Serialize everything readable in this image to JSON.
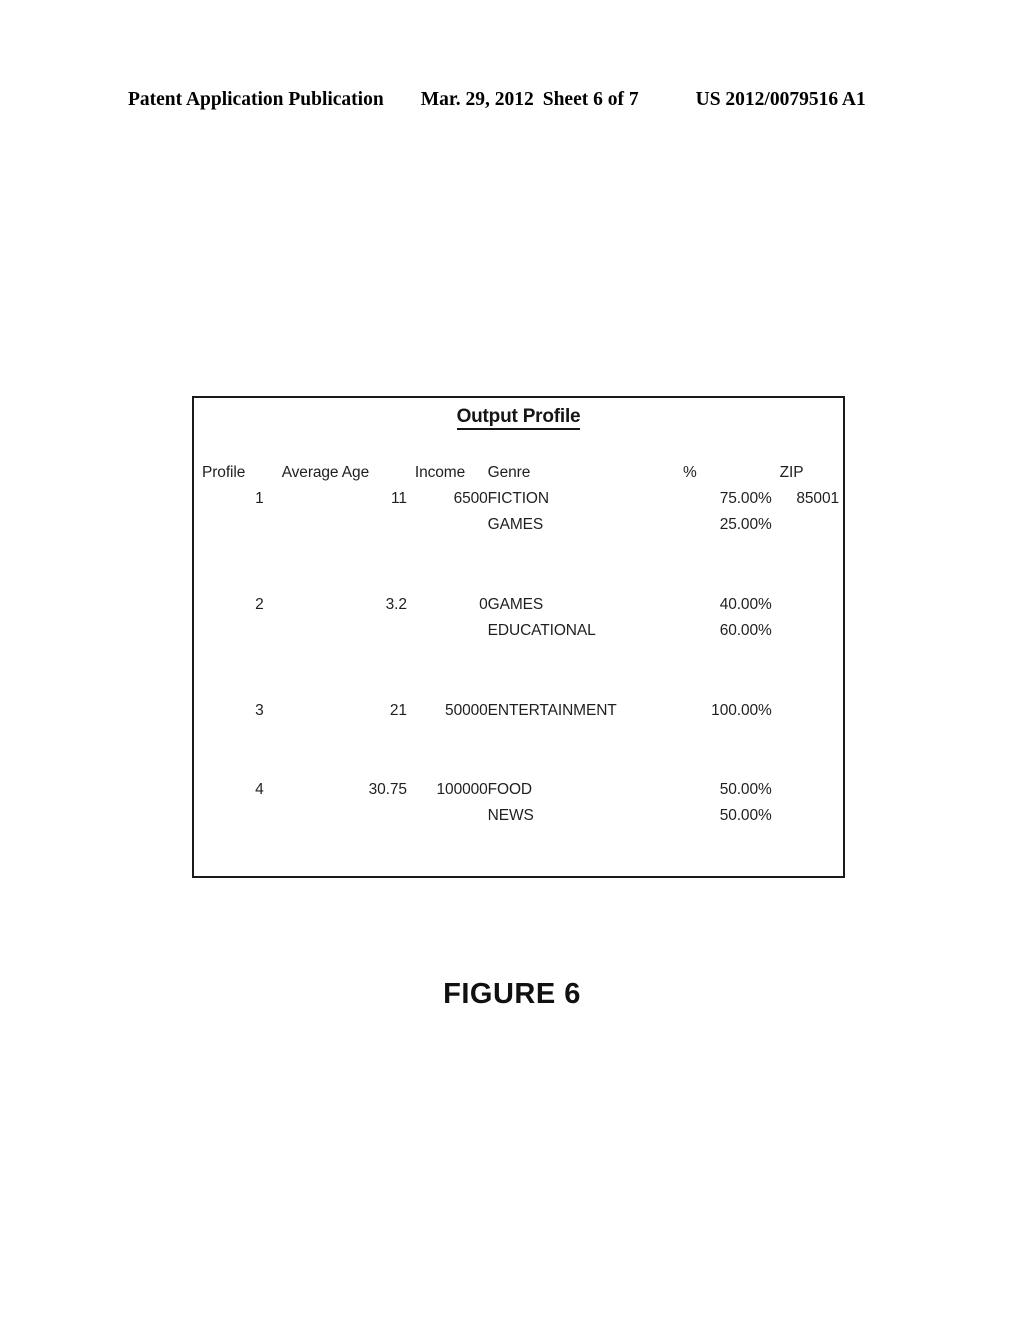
{
  "header": {
    "publication": "Patent Application Publication",
    "date": "Mar. 29, 2012",
    "sheet": "Sheet 6 of 7",
    "document_number": "US 2012/0079516 A1"
  },
  "figure": {
    "caption": "FIGURE 6",
    "table_title": "Output Profile",
    "columns": [
      {
        "key": "profile",
        "label": "Profile"
      },
      {
        "key": "average_age",
        "label": "Average Age"
      },
      {
        "key": "income",
        "label": "Income"
      },
      {
        "key": "genre",
        "label": "Genre"
      },
      {
        "key": "percent",
        "label": "%"
      },
      {
        "key": "zip",
        "label": "ZIP"
      }
    ],
    "rows": [
      {
        "profile": "1",
        "average_age": "11",
        "income": "6500",
        "genre": "FICTION",
        "percent": "75.00%",
        "zip": "85001"
      },
      {
        "profile": "",
        "average_age": "",
        "income": "",
        "genre": "GAMES",
        "percent": "25.00%",
        "zip": ""
      },
      {
        "profile": "",
        "average_age": "",
        "income": "",
        "genre": "",
        "percent": "",
        "zip": ""
      },
      {
        "profile": "2",
        "average_age": "3.2",
        "income": "0",
        "genre": "GAMES",
        "percent": "40.00%",
        "zip": ""
      },
      {
        "profile": "",
        "average_age": "",
        "income": "",
        "genre": "EDUCATIONAL",
        "percent": "60.00%",
        "zip": ""
      },
      {
        "profile": "",
        "average_age": "",
        "income": "",
        "genre": "",
        "percent": "",
        "zip": ""
      },
      {
        "profile": "3",
        "average_age": "21",
        "income": "50000",
        "genre": "ENTERTAINMENT",
        "percent": "100.00%",
        "zip": ""
      },
      {
        "profile": "",
        "average_age": "",
        "income": "",
        "genre": "",
        "percent": "",
        "zip": ""
      },
      {
        "profile": "4",
        "average_age": "30.75",
        "income": "100000",
        "genre": "FOOD",
        "percent": "50.00%",
        "zip": ""
      },
      {
        "profile": "",
        "average_age": "",
        "income": "",
        "genre": "NEWS",
        "percent": "50.00%",
        "zip": ""
      }
    ]
  },
  "chart_data": {
    "type": "table",
    "title": "Output Profile",
    "columns": [
      "Profile",
      "Average Age",
      "Income",
      "Genre",
      "%",
      "ZIP"
    ],
    "rows": [
      [
        "1",
        "11",
        "6500",
        "FICTION",
        "75.00%",
        "85001"
      ],
      [
        "",
        "",
        "",
        "GAMES",
        "25.00%",
        ""
      ],
      [
        "2",
        "3.2",
        "0",
        "GAMES",
        "40.00%",
        ""
      ],
      [
        "",
        "",
        "",
        "EDUCATIONAL",
        "60.00%",
        ""
      ],
      [
        "3",
        "21",
        "50000",
        "ENTERTAINMENT",
        "100.00%",
        ""
      ],
      [
        "4",
        "30.75",
        "100000",
        "FOOD",
        "50.00%",
        ""
      ],
      [
        "",
        "",
        "",
        "NEWS",
        "50.00%",
        ""
      ]
    ]
  },
  "colors": {
    "ink": "#000000",
    "border": "#1a1a1a",
    "page_background": "#ffffff"
  }
}
